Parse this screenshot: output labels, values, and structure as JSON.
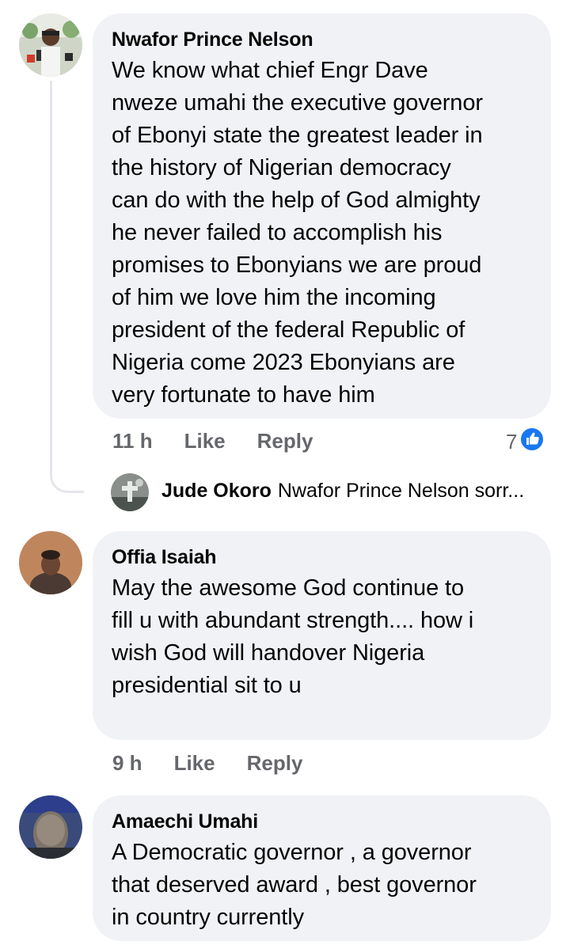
{
  "comments": [
    {
      "author": "Nwafor Prince Nelson",
      "text": "We know what chief Engr Dave\nnweze umahi the executive governor\nof Ebonyi state the greatest leader in\nthe history of Nigerian democracy\ncan do with the help of God almighty\nhe never failed to accomplish his\npromises to Ebonyians we are proud\nof him we love him the incoming\npresident of the federal Republic of\nNigeria come 2023 Ebonyians are\nvery fortunate to have him",
      "time": "11 h",
      "like_label": "Like",
      "reply_label": "Reply",
      "reaction_count": "7",
      "reaction_icon": "like-reaction-icon",
      "reply_preview": {
        "author": "Jude Okoro",
        "text": "Nwafor Prince Nelson sorr..."
      }
    },
    {
      "author": "Offia Isaiah",
      "text": "May the awesome God continue to\nfill u with abundant strength.... how i\nwish God will handover Nigeria\npresidential sit to u",
      "time": "9 h",
      "like_label": "Like",
      "reply_label": "Reply"
    },
    {
      "author": "Amaechi Umahi",
      "text": "A Democratic governor , a governor\nthat deserved award , best governor\nin country currently"
    }
  ],
  "colors": {
    "bubble": "#f0f2f5",
    "meta_text": "#65676b",
    "like_blue": "#1877f2",
    "thread_line": "#e4e6eb"
  }
}
